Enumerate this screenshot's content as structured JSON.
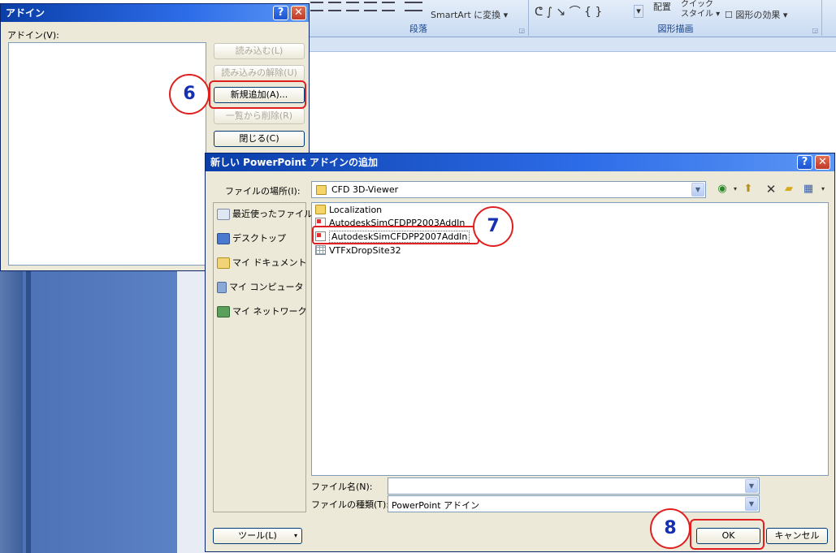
{
  "ribbon": {
    "smartart_label": "SmartArt に変換",
    "group_paragraph": "段落",
    "group_drawing": "図形描画",
    "arrange_label": "配置",
    "quick_style_label_1": "クイック",
    "quick_style_label_2": "スタイル",
    "shape_effects_label": "図形の効果"
  },
  "addin_dialog": {
    "title": "アドイン",
    "list_label": "アドイン(V):",
    "buttons": {
      "load": "読み込む(L)",
      "unload": "読み込みの解除(U)",
      "add_new": "新規追加(A)...",
      "remove": "一覧から削除(R)",
      "close": "閉じる(C)"
    }
  },
  "file_dialog": {
    "title": "新しい PowerPoint アドインの追加",
    "location_label": "ファイルの場所(I):",
    "location_value": "CFD 3D-Viewer",
    "places": [
      {
        "label": "最近使ったファイル"
      },
      {
        "label": "デスクトップ"
      },
      {
        "label": "マイ ドキュメント"
      },
      {
        "label": "マイ コンピュータ"
      },
      {
        "label": "マイ ネットワーク"
      }
    ],
    "files": [
      {
        "name": "Localization",
        "type": "folder"
      },
      {
        "name": "AutodeskSimCFDPP2003AddIn",
        "type": "addin"
      },
      {
        "name": "AutodeskSimCFDPP2007AddIn",
        "type": "addin"
      },
      {
        "name": "VTFxDropSite32",
        "type": "grid"
      }
    ],
    "filename_label": "ファイル名(N):",
    "filename_value": "",
    "filetype_label": "ファイルの種類(T):",
    "filetype_value": "PowerPoint アドイン",
    "tools_label": "ツール(L)",
    "ok_label": "OK",
    "cancel_label": "キャンセル"
  },
  "callouts": {
    "step6": "6",
    "step7": "7",
    "step8": "8"
  },
  "colors": {
    "title_bar": "#0a3ea8",
    "dialog_bg": "#ece9d8",
    "callout_border": "#e02020",
    "callout_text": "#1530b0"
  }
}
